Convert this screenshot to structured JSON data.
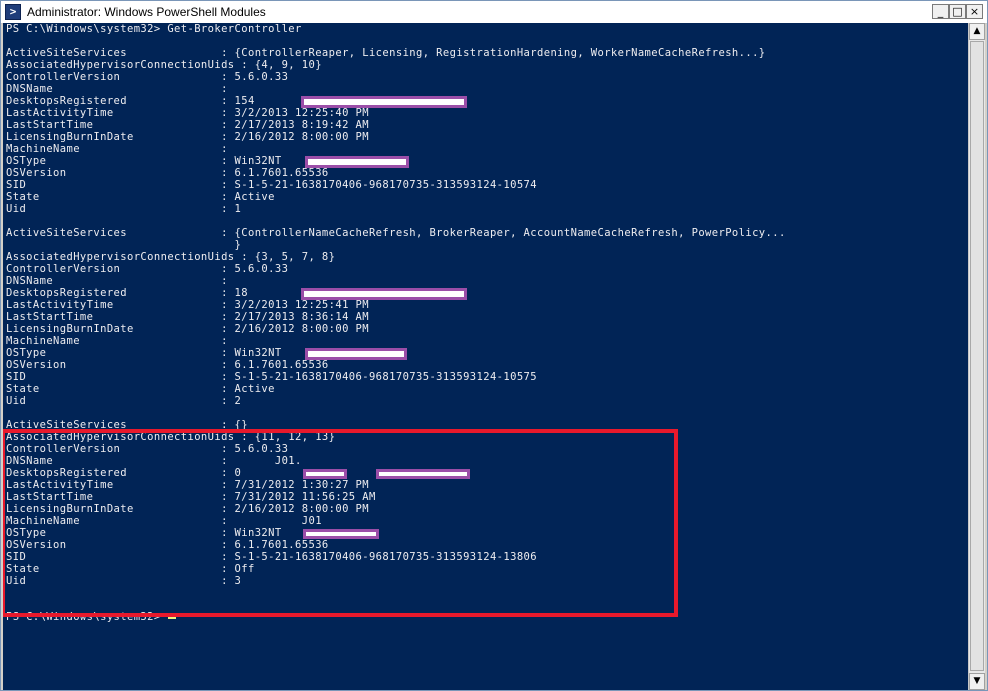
{
  "window": {
    "title": "Administrator: Windows PowerShell Modules",
    "app_icon_glyph": ">",
    "minimize_glyph": "_",
    "maximize_glyph": "□",
    "close_glyph": "×"
  },
  "console": {
    "lines": [
      "PS C:\\Windows\\system32> Get-BrokerController",
      "",
      "ActiveSiteServices              : {ControllerReaper, Licensing, RegistrationHardening, WorkerNameCacheRefresh...}",
      "AssociatedHypervisorConnectionUids : {4, 9, 10}",
      "ControllerVersion               : 5.6.0.33",
      "DNSName                         :",
      "DesktopsRegistered              : 154",
      "LastActivityTime                : 3/2/2013 12:25:40 PM",
      "LastStartTime                   : 2/17/2013 8:19:42 AM",
      "LicensingBurnInDate             : 2/16/2012 8:00:00 PM",
      "MachineName                     :",
      "OSType                          : Win32NT",
      "OSVersion                       : 6.1.7601.65536",
      "SID                             : S-1-5-21-1638170406-968170735-313593124-10574",
      "State                           : Active",
      "Uid                             : 1",
      "",
      "ActiveSiteServices              : {ControllerNameCacheRefresh, BrokerReaper, AccountNameCacheRefresh, PowerPolicy...",
      "                                  }",
      "AssociatedHypervisorConnectionUids : {3, 5, 7, 8}",
      "ControllerVersion               : 5.6.0.33",
      "DNSName                         :",
      "DesktopsRegistered              : 18",
      "LastActivityTime                : 3/2/2013 12:25:41 PM",
      "LastStartTime                   : 2/17/2013 8:36:14 AM",
      "LicensingBurnInDate             : 2/16/2012 8:00:00 PM",
      "MachineName                     :",
      "OSType                          : Win32NT",
      "OSVersion                       : 6.1.7601.65536",
      "SID                             : S-1-5-21-1638170406-968170735-313593124-10575",
      "State                           : Active",
      "Uid                             : 2",
      "",
      "ActiveSiteServices              : {}",
      "AssociatedHypervisorConnectionUids : {11, 12, 13}",
      "ControllerVersion               : 5.6.0.33",
      "DNSName                         :       J01.",
      "DesktopsRegistered              : 0",
      "LastActivityTime                : 7/31/2012 1:30:27 PM",
      "LastStartTime                   : 7/31/2012 11:56:25 AM",
      "LicensingBurnInDate             : 2/16/2012 8:00:00 PM",
      "MachineName                     :           J01",
      "OSType                          : Win32NT",
      "OSVersion                       : 6.1.7601.65536",
      "SID                             : S-1-5-21-1638170406-968170735-313593124-13806",
      "State                           : Off",
      "Uid                             : 3",
      "",
      "",
      "PS C:\\Windows\\system32> "
    ]
  },
  "colors": {
    "console_bg": "#012456",
    "console_text": "#eeedf0",
    "highlight_border": "#e8192c",
    "redaction_border": "#9b4ea8"
  },
  "icons": [
    "powershell-icon",
    "minimize-icon",
    "maximize-icon",
    "close-icon",
    "scroll-up-icon",
    "scroll-down-icon"
  ]
}
